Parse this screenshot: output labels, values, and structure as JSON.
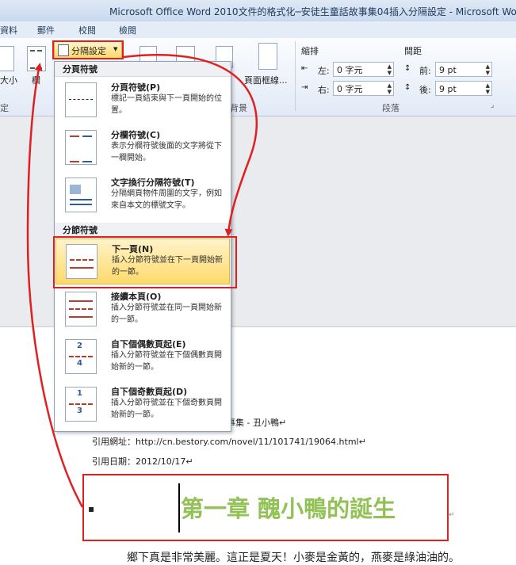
{
  "window": {
    "title": "Microsoft Office Word 2010文件的格式化─安徒生童話故事集04插入分隔設定 - Microsoft Wo"
  },
  "tabs": [
    "資料",
    "郵件",
    "校閱",
    "檢閱"
  ],
  "ribbon": {
    "breaks_button": "分隔設定",
    "left_label_1": "大小",
    "left_label_2": "欄",
    "page_borders": "頁面框線...",
    "group_background": "背景",
    "indent_header": "縮排",
    "indent_left_label": "左:",
    "indent_left_value": "0 字元",
    "indent_right_label": "右:",
    "indent_right_value": "0 字元",
    "spacing_header": "間距",
    "spacing_before_label": "前:",
    "spacing_before_value": "9 pt",
    "spacing_after_label": "後:",
    "spacing_after_value": "9 pt",
    "group_paragraph": "段落",
    "group_left": "定"
  },
  "menu": {
    "page_breaks_header": "分頁符號",
    "section_breaks_header": "分節符號",
    "items": [
      {
        "title": "分頁符號(P)",
        "desc": "標記一頁結束與下一頁開始的位置。"
      },
      {
        "title": "分欄符號(C)",
        "desc": "表示分欄符號後面的文字將從下一欄開始。"
      },
      {
        "title": "文字換行分隔符號(T)",
        "desc": "分隔網頁物件周圍的文字，例如來自本文的標號文字。"
      },
      {
        "title": "下一頁(N)",
        "desc": "插入分節符號並在下一頁開始新的一節。"
      },
      {
        "title": "接續本頁(O)",
        "desc": "插入分節符號並在同一頁開始新的一節。"
      },
      {
        "title": "自下個偶數頁起(E)",
        "desc": "插入分節符號並在下個偶數頁開始新的一節。"
      },
      {
        "title": "自下個奇數頁起(D)",
        "desc": "插入分節符號並在下個奇數頁開始新的一節。"
      }
    ]
  },
  "document": {
    "source_fragment": "事集 - 丑小鴨↵",
    "url_line": "引用網址：http://cn.bestory.com/novel/11/101741/19064.html↵",
    "date_line": "引用日期：2012/10/17↵",
    "chapter_title": "第一章  醜小鴨的誕生",
    "body_line": "鄉下真是非常美麗。這正是夏天！小麥是金黃的，燕麥是綠油油的。"
  },
  "colors": {
    "chapter": "#92c255",
    "highlight": "#e02020"
  }
}
